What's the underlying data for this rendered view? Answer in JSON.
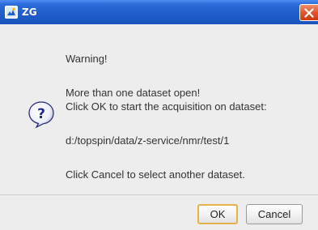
{
  "dialog": {
    "title": "ZG",
    "colors": {
      "titlebar": "#2a6bd8",
      "close_button": "#e0552c",
      "body_background": "#ededed",
      "default_button_border": "#e7b24a"
    },
    "icons": {
      "title": "application-icon",
      "close": "close-icon",
      "message": "help-question-icon"
    },
    "message": {
      "line1": "Warning!",
      "line2": "More than one dataset open!",
      "line3": "Click OK to start the acquisition on dataset:",
      "line4": "d:/topspin/data/z-service/nmr/test/1",
      "line5": "Click Cancel to select another dataset."
    },
    "buttons": {
      "ok": "OK",
      "cancel": "Cancel"
    }
  }
}
